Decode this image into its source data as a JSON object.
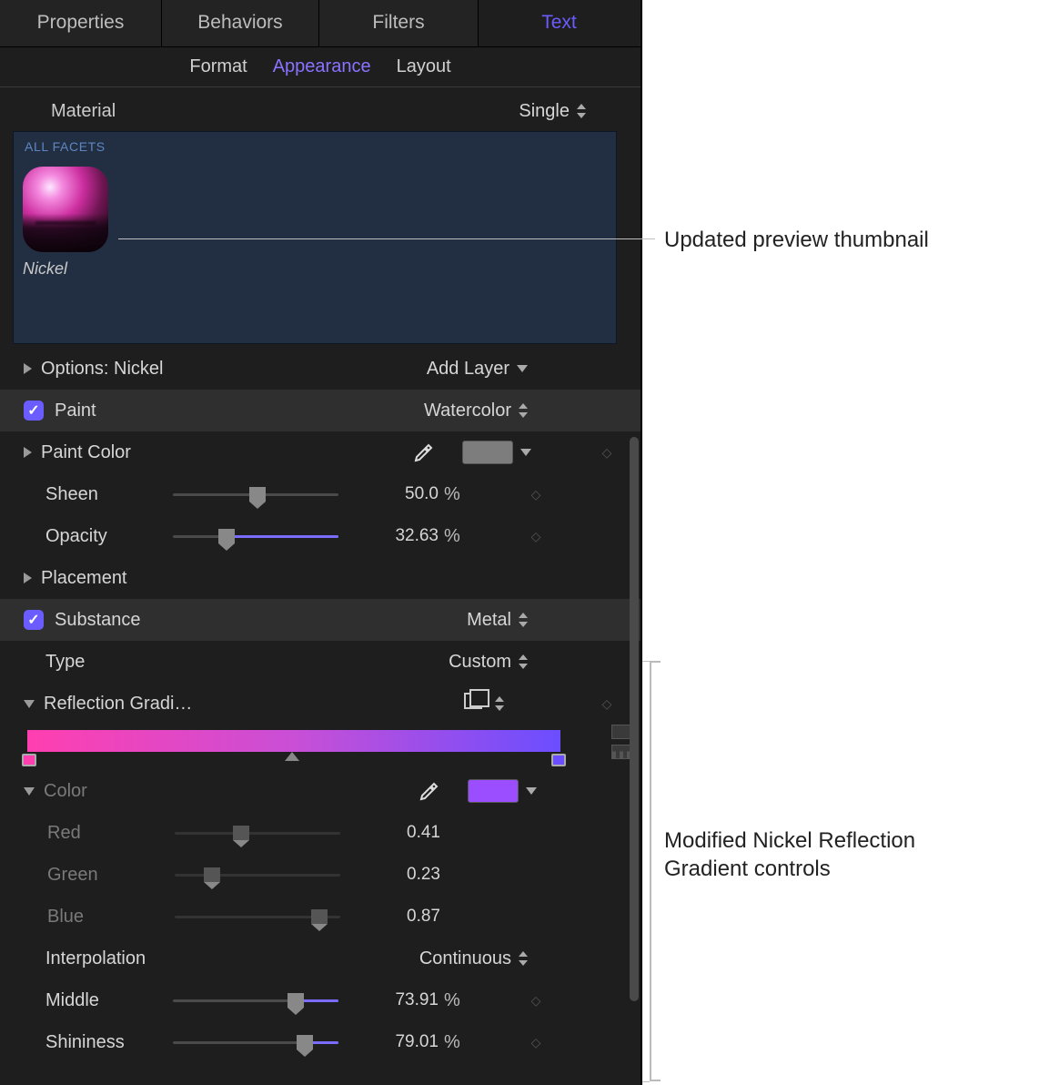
{
  "tabs_top": {
    "properties": "Properties",
    "behaviors": "Behaviors",
    "filters": "Filters",
    "text": "Text"
  },
  "sub_tabs": {
    "format": "Format",
    "appearance": "Appearance",
    "layout": "Layout"
  },
  "material": {
    "label": "Material",
    "mode": "Single",
    "facets_label": "ALL FACETS",
    "thumb_caption": "Nickel"
  },
  "options": {
    "label": "Options: Nickel",
    "add_layer": "Add Layer"
  },
  "paint": {
    "title": "Paint",
    "type": "Watercolor",
    "color_label": "Paint Color",
    "sheen_label": "Sheen",
    "sheen_value": "50.0",
    "sheen_unit": "%",
    "opacity_label": "Opacity",
    "opacity_value": "32.63",
    "opacity_unit": "%",
    "placement_label": "Placement"
  },
  "substance": {
    "title": "Substance",
    "kind": "Metal",
    "type_label": "Type",
    "type_value": "Custom"
  },
  "reflection": {
    "label": "Reflection Gradi…"
  },
  "gradient": {
    "color_label": "Color",
    "red_label": "Red",
    "red_val": "0.41",
    "green_label": "Green",
    "green_val": "0.23",
    "blue_label": "Blue",
    "blue_val": "0.87",
    "interp_label": "Interpolation",
    "interp_val": "Continuous",
    "middle_label": "Middle",
    "middle_val": "73.91",
    "middle_unit": "%",
    "shine_label": "Shininess",
    "shine_val": "79.01",
    "shine_unit": "%"
  },
  "callouts": {
    "c1": "Updated preview thumbnail",
    "c2a": "Modified Nickel Reflection",
    "c2b": "Gradient controls"
  },
  "colors": {
    "accent": "#6a5cff"
  }
}
